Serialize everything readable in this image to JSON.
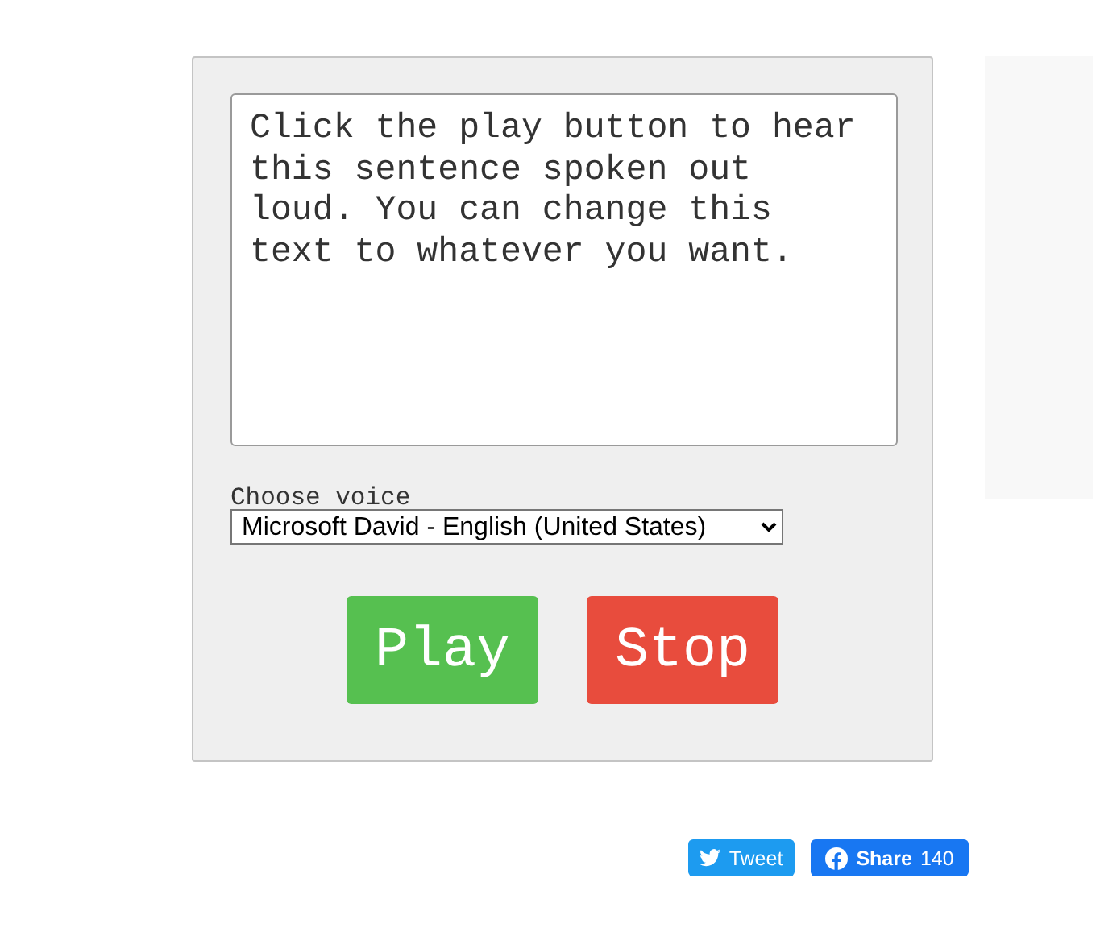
{
  "text_input": {
    "value": "Click the play button to hear this sentence spoken out loud. You can change this text to whatever you want."
  },
  "voice": {
    "label": "Choose voice",
    "value": "Microsoft David - English (United States)"
  },
  "buttons": [
    {
      "kind": "play",
      "label": "Play"
    },
    {
      "kind": "stop",
      "label": "Stop"
    }
  ],
  "social": [
    {
      "kind": "tweet",
      "label": "Tweet"
    },
    {
      "kind": "share",
      "label": "Share",
      "count": "140"
    }
  ]
}
